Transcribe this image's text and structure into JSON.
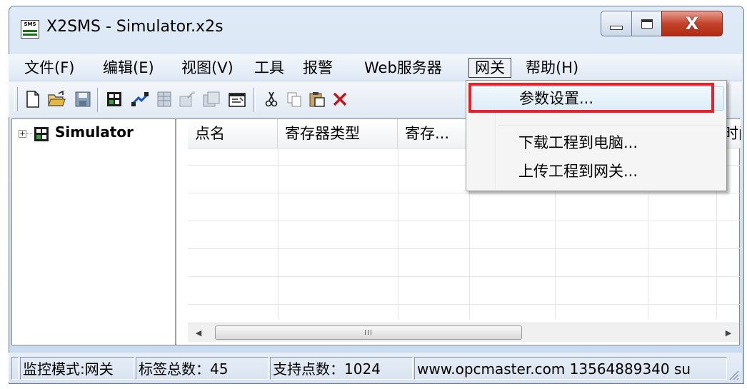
{
  "window": {
    "title": "X2SMS - Simulator.x2s",
    "app_icon_text": "SMS",
    "buttons": {
      "minimize": "minimize-icon",
      "maximize": "maximize-icon",
      "close": "close-icon"
    },
    "close_glyph": "X"
  },
  "menubar": {
    "items": [
      {
        "label": "文件(F)"
      },
      {
        "label": "编辑(E)"
      },
      {
        "label": "视图(V)"
      },
      {
        "label": "工具"
      },
      {
        "label": "报警"
      },
      {
        "label": "Web服务器"
      },
      {
        "label": "网关"
      },
      {
        "label": "帮助(H)"
      }
    ],
    "active_index": 6
  },
  "toolbar": {
    "icons": [
      "new-file-icon",
      "open-folder-icon",
      "save-icon",
      "device-icon",
      "connect-icon",
      "grid-icon",
      "wizard-icon",
      "group-icon",
      "properties-icon",
      "cut-icon",
      "copy-icon",
      "paste-icon",
      "delete-icon"
    ]
  },
  "tree": {
    "root_label": "Simulator",
    "expand_glyph": "+"
  },
  "grid": {
    "columns": [
      "点名",
      "寄存器类型",
      "寄存...",
      "",
      "",
      "",
      "时间"
    ]
  },
  "hscroll": {
    "left": "◀",
    "right": "▶",
    "grip": "III"
  },
  "statusbar": {
    "cells": [
      "",
      "监控模式:网关",
      "标签总数：45",
      "支持点数：1024",
      "www.opcmaster.com 13564889340 su"
    ]
  },
  "dropdown": {
    "items": [
      {
        "label": "参数设置..."
      },
      {
        "label": "下载工程到电脑..."
      },
      {
        "label": "上传工程到网关..."
      }
    ],
    "highlight_color": "#e8202a"
  }
}
